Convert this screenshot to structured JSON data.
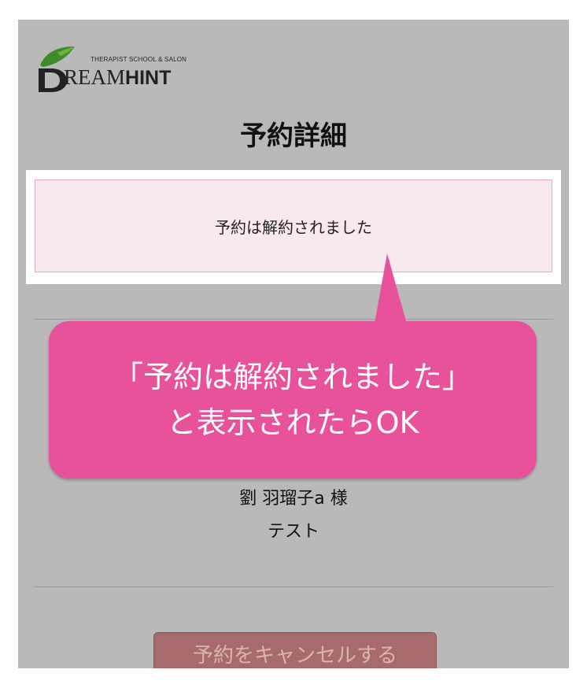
{
  "logo": {
    "tagline": "THERAPIST SCHOOL & SALON",
    "word_main": "REAM",
    "word_bold": "HINT",
    "leaf_color": "#3f8a2a"
  },
  "page": {
    "title": "予約詳細"
  },
  "alert": {
    "message": "予約は解約されました"
  },
  "customer": {
    "name": "劉 羽瑠子a 様",
    "note": "テスト"
  },
  "actions": {
    "cancel_label": "予約をキャンセルする"
  },
  "callout": {
    "line1": "「予約は解約されました」",
    "line2": "と表示されたらOK",
    "color": "#e8529b"
  }
}
